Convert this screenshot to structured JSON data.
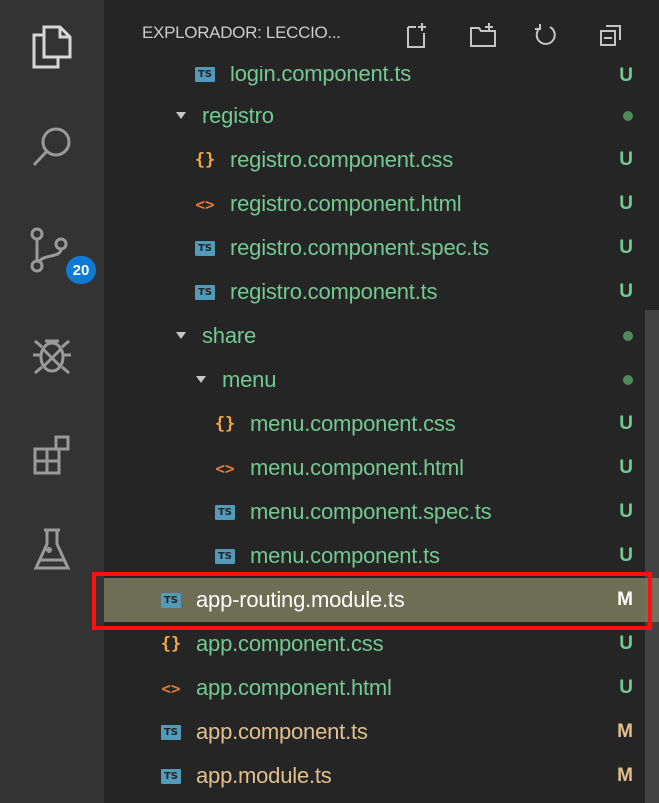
{
  "explorer": {
    "title": "EXPLORADOR: LECCIO..."
  },
  "activity": {
    "scm_badge": "20",
    "icons": [
      "files-icon",
      "search-icon",
      "source-control-icon",
      "debug-icon",
      "extensions-icon",
      "testing-icon"
    ]
  },
  "tree": [
    {
      "label": "login.component.ts",
      "type": "ts",
      "level": 2,
      "status": "U"
    },
    {
      "label": "registro",
      "type": "folder",
      "level": 1,
      "status": "dot"
    },
    {
      "label": "registro.component.css",
      "type": "css",
      "level": 2,
      "status": "U"
    },
    {
      "label": "registro.component.html",
      "type": "html",
      "level": 2,
      "status": "U"
    },
    {
      "label": "registro.component.spec.ts",
      "type": "ts",
      "level": 2,
      "status": "U"
    },
    {
      "label": "registro.component.ts",
      "type": "ts",
      "level": 2,
      "status": "U"
    },
    {
      "label": "share",
      "type": "folder",
      "level": 1,
      "status": "dot"
    },
    {
      "label": "menu",
      "type": "folder",
      "level": 2,
      "status": "dot"
    },
    {
      "label": "menu.component.css",
      "type": "css",
      "level": 3,
      "status": "U"
    },
    {
      "label": "menu.component.html",
      "type": "html",
      "level": 3,
      "status": "U"
    },
    {
      "label": "menu.component.spec.ts",
      "type": "ts",
      "level": 3,
      "status": "U"
    },
    {
      "label": "menu.component.ts",
      "type": "ts",
      "level": 3,
      "status": "U"
    },
    {
      "label": "app-routing.module.ts",
      "type": "ts",
      "level": 0,
      "status": "M",
      "selected": true
    },
    {
      "label": "app.component.css",
      "type": "css",
      "level": 0,
      "status": "U"
    },
    {
      "label": "app.component.html",
      "type": "html",
      "level": 0,
      "status": "U"
    },
    {
      "label": "app.component.ts",
      "type": "ts",
      "level": 0,
      "status": "M"
    },
    {
      "label": "app.module.ts",
      "type": "ts",
      "level": 0,
      "status": "M"
    }
  ],
  "icons": {
    "ts": "TS",
    "css": "{}",
    "html": "<>"
  },
  "colors": {
    "untracked": "#73c991",
    "modified": "#e2c08d",
    "selection": "#6e6e54",
    "highlight_box": "#ff1010",
    "badge": "#0e7ad3"
  }
}
